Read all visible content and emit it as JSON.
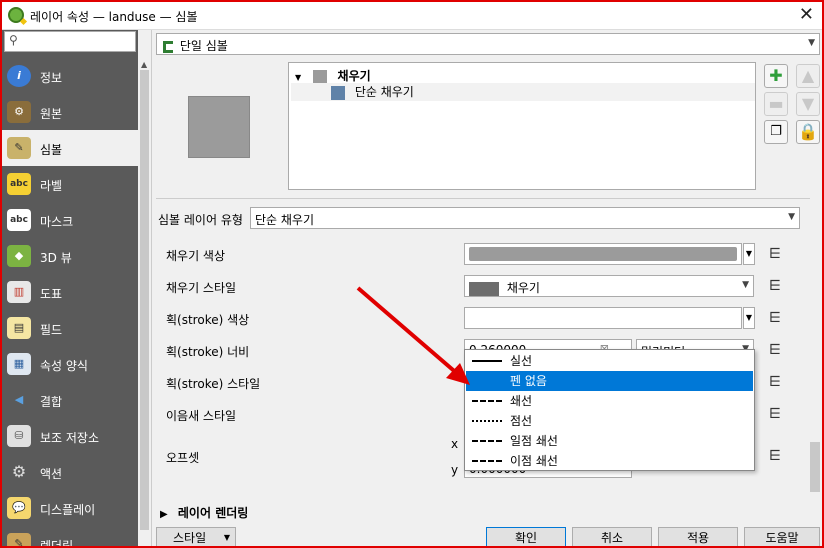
{
  "window": {
    "title": "레이어 속성 — landuse — 심볼"
  },
  "search": {
    "placeholder": ""
  },
  "sidebar": {
    "items": [
      {
        "label": "정보",
        "icon": "info-icon"
      },
      {
        "label": "원본",
        "icon": "source-icon"
      },
      {
        "label": "심볼",
        "icon": "symbology-icon",
        "active": true
      },
      {
        "label": "라벨",
        "icon": "labels-icon"
      },
      {
        "label": "마스크",
        "icon": "mask-icon"
      },
      {
        "label": "3D 뷰",
        "icon": "3d-view-icon"
      },
      {
        "label": "도표",
        "icon": "diagrams-icon"
      },
      {
        "label": "필드",
        "icon": "fields-icon"
      },
      {
        "label": "속성 양식",
        "icon": "attributes-form-icon"
      },
      {
        "label": "결합",
        "icon": "joins-icon"
      },
      {
        "label": "보조 저장소",
        "icon": "auxiliary-storage-icon"
      },
      {
        "label": "액션",
        "icon": "actions-icon"
      },
      {
        "label": "디스플레이",
        "icon": "display-icon"
      },
      {
        "label": "렌더링",
        "icon": "rendering-icon"
      }
    ]
  },
  "renderer": {
    "selected": "단일 심볼"
  },
  "symbol_tree": {
    "root": "채우기",
    "child": "단순 채우기"
  },
  "symbol_layer_type": {
    "label": "심볼 레이어 유형",
    "value": "단순 채우기"
  },
  "props": {
    "fill_color": "채우기 색상",
    "fill_style": "채우기 스타일",
    "fill_style_value": "채우기",
    "stroke_color": "획(stroke) 색상",
    "stroke_width": "획(stroke) 너비",
    "stroke_width_value": "0.260000",
    "stroke_width_unit": "밀리미터",
    "stroke_style": "획(stroke) 스타일",
    "join_style": "이음새 스타일",
    "offset": "오프셋",
    "offset_x": "x",
    "offset_y": "y",
    "offset_y_value": "0.000000"
  },
  "stroke_style_options": [
    "실선",
    "펜 없음",
    "쇄선",
    "점선",
    "일점 쇄선",
    "이점 쇄선"
  ],
  "layer_rendering": "레이어 렌더링",
  "buttons": {
    "style": "스타일",
    "ok": "확인",
    "cancel": "취소",
    "apply": "적용",
    "help": "도움말"
  },
  "colors": {
    "accent": "#0078d7",
    "annotation_arrow": "#e00000",
    "symbol_fill": "#9b9b9b"
  }
}
